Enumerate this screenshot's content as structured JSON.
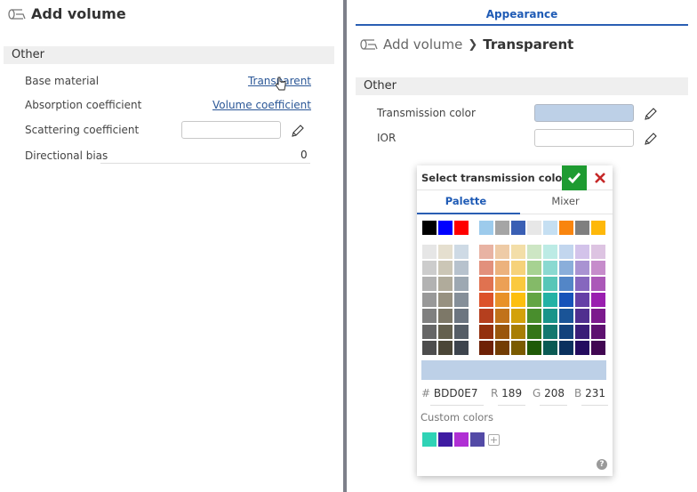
{
  "left_panel": {
    "title": "Add volume",
    "section": "Other",
    "properties": [
      {
        "label": "Base material",
        "link": "Transparent"
      },
      {
        "label": "Absorption coefficient",
        "link": "Volume coefficient"
      },
      {
        "label": "Scattering coefficient",
        "value": ""
      },
      {
        "label": "Directional bias",
        "value": "0"
      }
    ]
  },
  "right_panel": {
    "tab": "Appearance",
    "breadcrumb": {
      "parent": "Add volume",
      "current": "Transparent"
    },
    "section": "Other",
    "properties": [
      {
        "label": "Transmission color",
        "color": "#BDD0E7"
      },
      {
        "label": "IOR",
        "value": ""
      }
    ]
  },
  "color_picker": {
    "title": "Select transmission color",
    "tabs": [
      {
        "label": "Palette",
        "active": true
      },
      {
        "label": "Mixer",
        "active": false
      }
    ],
    "basic_colors": [
      "#000000",
      "#0000FF",
      "#FF0000"
    ],
    "recent_colors": [
      "#9DCBEC",
      "#A5A5A5",
      "#3A5FB4",
      "#E7E7E7",
      "#C5DFF2",
      "#F9850F",
      "#7F7F7F",
      "#FEB80A"
    ],
    "gray_grid": [
      [
        "#E6E6E6",
        "#E5DFCF",
        "#CEDAE5"
      ],
      [
        "#CCCCCC",
        "#CBC6B6",
        "#B7C2CD"
      ],
      [
        "#B2B2B2",
        "#B0AB9B",
        "#9DA8B2"
      ],
      [
        "#999999",
        "#979181",
        "#858F99"
      ],
      [
        "#808080",
        "#7D7868",
        "#6C7580"
      ],
      [
        "#666666",
        "#64604F",
        "#555D66"
      ],
      [
        "#4D4D4D",
        "#4B4637",
        "#3D444D"
      ]
    ],
    "color_grid": [
      [
        "#E8B3A3",
        "#EECBA6",
        "#F3DEA8",
        "#CDE6C4",
        "#BCEBE5",
        "#C2D6EE",
        "#D3C3EA",
        "#DDC4E2"
      ],
      [
        "#E2907C",
        "#ECB27D",
        "#F6D27A",
        "#A7D292",
        "#8AD9D1",
        "#8AAEDA",
        "#A993D2",
        "#C68CCB"
      ],
      [
        "#E07250",
        "#ECA055",
        "#FAC93F",
        "#84BA68",
        "#57C6B8",
        "#5386C7",
        "#8667BE",
        "#AB58B8"
      ],
      [
        "#DC522A",
        "#E89128",
        "#FDBF0F",
        "#63A544",
        "#23B2A5",
        "#1653B9",
        "#6540A6",
        "#9A1FAF"
      ],
      [
        "#B53F1E",
        "#C1721A",
        "#D3A10A",
        "#498E2D",
        "#1A948A",
        "#1A5497",
        "#502F8F",
        "#7C1A8D"
      ],
      [
        "#93300E",
        "#9A560D",
        "#A87E05",
        "#357519",
        "#12776F",
        "#12427C",
        "#3A1D78",
        "#5E1170"
      ],
      [
        "#6E2106",
        "#733D04",
        "#7B5B00",
        "#1F5A07",
        "#095A53",
        "#0A315E",
        "#240C5F",
        "#410752"
      ]
    ],
    "selected_color": "#BDD0E7",
    "hex": {
      "label": "#",
      "value": "BDD0E7"
    },
    "r": {
      "label": "R",
      "value": "189"
    },
    "g": {
      "label": "G",
      "value": "208"
    },
    "b": {
      "label": "B",
      "value": "231"
    },
    "custom_label": "Custom colors",
    "custom_colors": [
      "#2FD3B6",
      "#3F1BA2",
      "#B02FD4",
      "#534AA6"
    ],
    "add_symbol": "+",
    "help_symbol": "?"
  }
}
